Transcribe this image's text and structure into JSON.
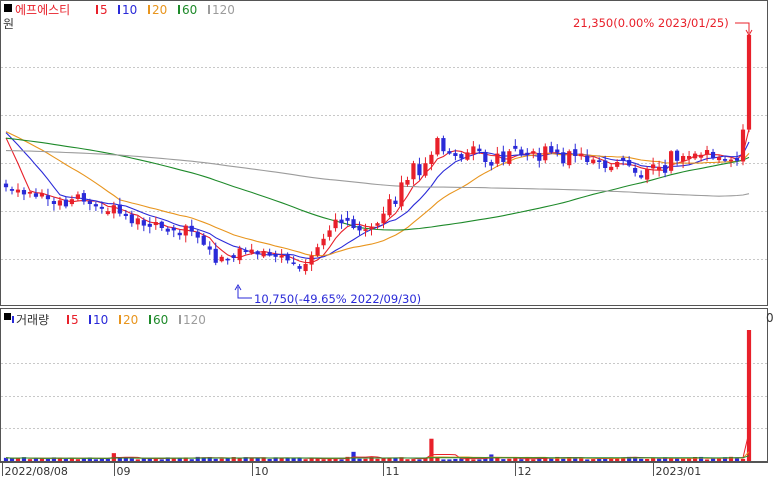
{
  "colors": {
    "up": "#e8202a",
    "down": "#2a2ad8",
    "ma5": "#e8202a",
    "ma10": "#2a2ad8",
    "ma20": "#e8951e",
    "ma60": "#1e8a2a",
    "ma120": "#9c9c9c",
    "annotation": "#e8202a",
    "annotation_low": "#2a2ad8",
    "grid": "#c8c8c8",
    "frame": "#444444"
  },
  "price_panel": {
    "legend": {
      "stock_name": "에프에스티",
      "periods": [
        "5",
        "10",
        "20",
        "60",
        "120"
      ]
    },
    "side_label": "원",
    "high_annotation": "21,350(0.00% 2023/01/25)",
    "low_annotation": "10,750(-49.65% 2022/09/30)"
  },
  "volume_panel": {
    "legend": {
      "title": "거래량",
      "periods": [
        "5",
        "10",
        "20",
        "60",
        "120"
      ]
    },
    "side_label": "0"
  },
  "x_axis": {
    "ticks": [
      "2022/08/08",
      "09",
      "10",
      "11",
      "12",
      "2023/01"
    ]
  },
  "chart_data": {
    "type": "candlestick",
    "x_range": [
      "2022/08/08",
      "2023/01/25"
    ],
    "y_range": [
      10300,
      22300
    ],
    "y_gridlines": [
      12000,
      14000,
      16000,
      18000,
      20000
    ],
    "ma_periods": [
      5,
      10,
      20,
      60,
      120
    ],
    "high": {
      "date": "2023/01/25",
      "value": 21350,
      "change": "0.00%"
    },
    "low": {
      "date": "2022/09/30",
      "value": 10750,
      "change": "-49.65%"
    },
    "close_series": [
      15000,
      14850,
      14900,
      14700,
      14800,
      14600,
      14750,
      14500,
      14300,
      14450,
      14200,
      14500,
      14700,
      14400,
      14300,
      14200,
      14100,
      14000,
      14250,
      13900,
      13800,
      13500,
      13700,
      13400,
      13350,
      13550,
      13300,
      13150,
      13200,
      13000,
      13400,
      13150,
      12900,
      12600,
      12400,
      11850,
      12100,
      11950,
      12050,
      12450,
      12300,
      12400,
      12200,
      12300,
      12150,
      12100,
      12150,
      11950,
      11800,
      11600,
      11800,
      12150,
      12500,
      12850,
      13200,
      13650,
      13500,
      13600,
      13300,
      13200,
      13250,
      13350,
      13500,
      13900,
      14500,
      14300,
      15200,
      15300,
      16000,
      15500,
      16000,
      16350,
      17050,
      16500,
      16400,
      16300,
      16200,
      16450,
      16700,
      16500,
      16050,
      15900,
      16400,
      16050,
      16500,
      16600,
      16350,
      16350,
      16500,
      16100,
      16700,
      16450,
      16450,
      16000,
      16500,
      16300,
      16400,
      16050,
      16150,
      16050,
      15800,
      15850,
      16050,
      16100,
      15900,
      15600,
      15400,
      15750,
      15950,
      15850,
      15600,
      16500,
      16100,
      16300,
      16300,
      16400,
      16350,
      16550,
      16200,
      16250,
      16100,
      16150,
      16100,
      17400,
      21350
    ],
    "volume_levels": {
      "baseline": "low",
      "spikes": [
        {
          "date": "2022/09/02",
          "level": 0.06
        },
        {
          "date": "2022/11/01",
          "level": 0.07
        },
        {
          "date": "2022/11/18",
          "level": 0.17
        },
        {
          "date": "2022/12/02",
          "level": 0.05
        },
        {
          "date": "2023/01/25",
          "level": 1.0
        }
      ]
    }
  }
}
